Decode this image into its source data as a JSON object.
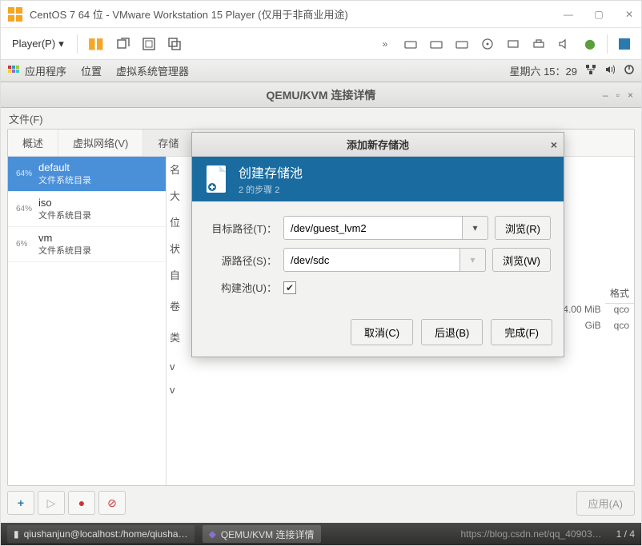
{
  "vmware": {
    "title": "CentOS 7 64 位 - VMware Workstation 15 Player (仅用于非商业用途)",
    "player_menu": "Player(P)"
  },
  "guest_panel": {
    "apps": "应用程序",
    "places": "位置",
    "virt_manager": "虚拟系统管理器",
    "clock": "星期六 15：29"
  },
  "qemu": {
    "title": "QEMU/KVM 连接详情",
    "file_menu": "文件(F)",
    "tabs": {
      "overview": "概述",
      "vnet": "虚拟网络(V)",
      "storage": "存储"
    },
    "pools": [
      {
        "pct": "64%",
        "name": "default",
        "type": "文件系统目录",
        "selected": true
      },
      {
        "pct": "64%",
        "name": "iso",
        "type": "文件系统目录",
        "selected": false
      },
      {
        "pct": "6%",
        "name": "vm",
        "type": "文件系统目录",
        "selected": false
      }
    ],
    "detail_labels": {
      "name": "名",
      "size": "大",
      "location": "位",
      "state": "状",
      "autostart": "自",
      "volumes": "卷",
      "col0": "类",
      "colfmt": "格式"
    },
    "peek": {
      "row1_size": "4.00 MiB",
      "row1_fmt": "qco",
      "row2_size": "GiB",
      "row2_fmt": "qco",
      "vprefix": "v"
    },
    "apply": "应用(A)"
  },
  "modal": {
    "title": "添加新存储池",
    "header_title": "创建存储池",
    "header_step": "2 的步骤 2",
    "target_label": "目标路径(T)：",
    "target_value": "/dev/guest_lvm2",
    "source_label": "源路径(S)：",
    "source_value": "/dev/sdc",
    "build_label": "构建池(U)：",
    "browse_r": "浏览(R)",
    "browse_w": "浏览(W)",
    "cancel": "取消(C)",
    "back": "后退(B)",
    "finish": "完成(F)"
  },
  "taskbar": {
    "terminal": "qiushanjun@localhost:/home/qiusha…",
    "qemu": "QEMU/KVM 连接详情",
    "watermark": "https://blog.csdn.net/qq_40903…",
    "pager": "1 / 4"
  }
}
